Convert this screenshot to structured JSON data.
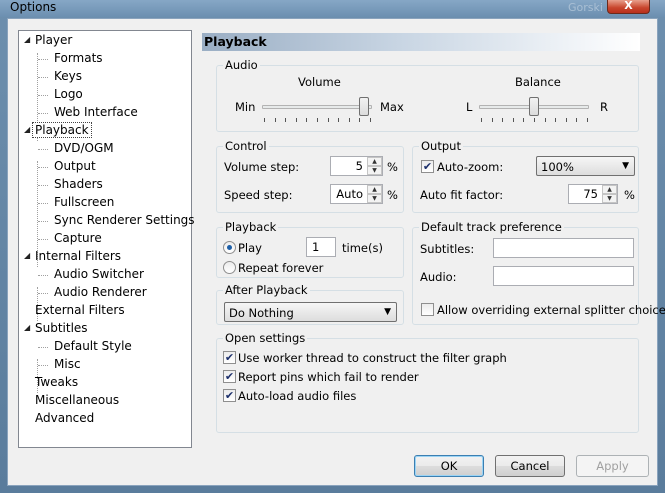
{
  "window": {
    "title": "Options",
    "ghost_title": "Gorski",
    "close_glyph": "X"
  },
  "tree": [
    {
      "label": "Player",
      "level": 0,
      "expander": "◢"
    },
    {
      "label": "Formats",
      "level": 1
    },
    {
      "label": "Keys",
      "level": 1
    },
    {
      "label": "Logo",
      "level": 1
    },
    {
      "label": "Web Interface",
      "level": 1
    },
    {
      "label": "Playback",
      "level": 0,
      "expander": "◢",
      "selected": true
    },
    {
      "label": "DVD/OGM",
      "level": 1
    },
    {
      "label": "Output",
      "level": 1
    },
    {
      "label": "Shaders",
      "level": 1
    },
    {
      "label": "Fullscreen",
      "level": 1
    },
    {
      "label": "Sync Renderer Settings",
      "level": 1
    },
    {
      "label": "Capture",
      "level": 1
    },
    {
      "label": "Internal Filters",
      "level": 0,
      "expander": "◢"
    },
    {
      "label": "Audio Switcher",
      "level": 1
    },
    {
      "label": "Audio Renderer",
      "level": 1
    },
    {
      "label": "External Filters",
      "level": 0
    },
    {
      "label": "Subtitles",
      "level": 0,
      "expander": "◢"
    },
    {
      "label": "Default Style",
      "level": 1
    },
    {
      "label": "Misc",
      "level": 1
    },
    {
      "label": "Tweaks",
      "level": 0
    },
    {
      "label": "Miscellaneous",
      "level": 0
    },
    {
      "label": "Advanced",
      "level": 0
    }
  ],
  "page": {
    "header": "Playback",
    "audio": {
      "legend": "Audio",
      "volume_label": "Volume",
      "volume_min": "Min",
      "volume_max": "Max",
      "volume_level": 0.93,
      "balance_label": "Balance",
      "balance_left": "L",
      "balance_right": "R",
      "balance_level": 0.5
    },
    "control": {
      "legend": "Control",
      "volume_step_label": "Volume step:",
      "volume_step_value": "5",
      "volume_step_unit": "%",
      "speed_step_label": "Speed step:",
      "speed_step_value": "Auto",
      "speed_step_unit": "%"
    },
    "output": {
      "legend": "Output",
      "autozoom_label": "Auto-zoom:",
      "autozoom_checked": true,
      "autozoom_value": "100%",
      "autofit_label": "Auto fit factor:",
      "autofit_value": "75",
      "autofit_unit": "%"
    },
    "playback": {
      "legend": "Playback",
      "play_label": "Play",
      "play_times": "1",
      "times_label": "time(s)",
      "repeat_label": "Repeat forever"
    },
    "track_pref": {
      "legend": "Default track preference",
      "subtitles_label": "Subtitles:",
      "subtitles_value": "",
      "audio_label": "Audio:",
      "audio_value": ""
    },
    "after_playback": {
      "legend": "After Playback",
      "value": "Do Nothing"
    },
    "allow_override_label": "Allow overriding external splitter choice",
    "open_settings": {
      "legend": "Open settings",
      "items": [
        {
          "label": "Use worker thread to construct the filter graph",
          "checked": true
        },
        {
          "label": "Report pins which fail to render",
          "checked": true
        },
        {
          "label": "Auto-load audio files",
          "checked": true
        }
      ]
    }
  },
  "buttons": {
    "ok": "OK",
    "cancel": "Cancel",
    "apply": "Apply"
  },
  "icons": {
    "check": "✔",
    "spin_up": "▲",
    "spin_down": "▼",
    "combo_arrow": "▼"
  }
}
